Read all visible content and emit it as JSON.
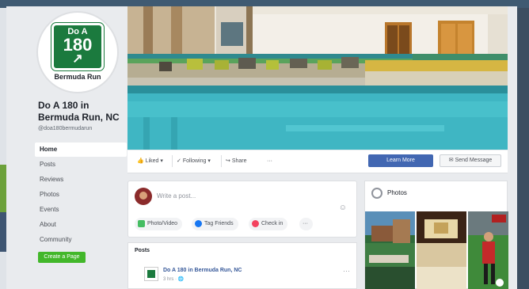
{
  "page": {
    "sign_line1": "Do A",
    "sign_number": "180",
    "sign_arrow": "↗",
    "sign_caption": "Bermuda Run",
    "name": "Do A 180 in Bermuda Run, NC",
    "handle": "@doa180bermudarun"
  },
  "nav": [
    "Home",
    "Posts",
    "Reviews",
    "Photos",
    "Events",
    "About",
    "Community"
  ],
  "create_page_label": "Create a Page",
  "action_bar": {
    "liked": "Liked",
    "following": "Following",
    "share": "Share",
    "more": "···",
    "learn_more": "Learn More",
    "send_message": "Send Message"
  },
  "composer": {
    "prompt": "Write a post...",
    "emoji": "☺",
    "chips": [
      {
        "label": "Photo/Video",
        "color": "#45bd62"
      },
      {
        "label": "Tag Friends",
        "color": "#1877f2"
      },
      {
        "label": "Check in",
        "color": "#f3425f"
      },
      {
        "label": "···",
        "color": "#f2f3f5"
      }
    ]
  },
  "posts": {
    "title": "Posts",
    "author": "Do A 180 in Bermuda Run, NC",
    "meta": "3 hrs · 🌐",
    "more": "···"
  },
  "photos": {
    "title": "Photos"
  },
  "colors": {
    "brand_green": "#1b7a3e",
    "fb_blue": "#4267b2",
    "page_bg": "#e9ebee"
  }
}
